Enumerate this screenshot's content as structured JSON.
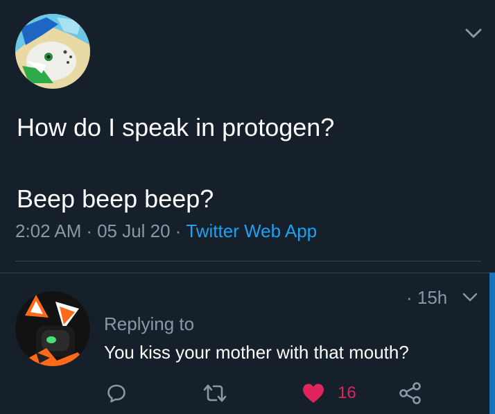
{
  "tweet": {
    "line1": "How do I speak in protogen?",
    "line2": "Beep beep beep?",
    "time": "2:02 AM",
    "date": "05 Jul 20",
    "source": "Twitter Web App",
    "separator": "·"
  },
  "reply": {
    "time": "· 15h",
    "replying_to": "Replying to",
    "text": "You kiss your mother with that mouth?",
    "like_count": "16"
  },
  "icons": [
    "chevron-down-icon",
    "comment-icon",
    "retweet-icon",
    "heart-icon",
    "share-icon"
  ],
  "colors": {
    "background": "#15202b",
    "text": "#ffffff",
    "muted": "#8899a6",
    "link": "#1da1f2",
    "like": "#e0245e",
    "divider": "#38444d",
    "accent_bar": "#1e72b8"
  }
}
